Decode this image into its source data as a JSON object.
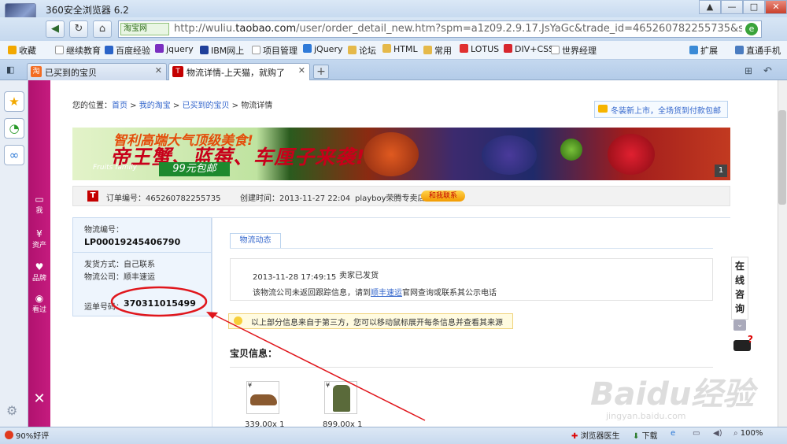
{
  "window": {
    "title": "360安全浏览器 6.2"
  },
  "nav": {
    "site_label": "淘宝网",
    "url_prefix": "http://wuliu.",
    "url_domain": "taobao.com",
    "url_suffix": "/user/order_detail_new.htm?spm=a1z09.2.9.17.JsYaGc&trade_id=465260782255735&seller_ic"
  },
  "bookmarks": {
    "favorites": "收藏",
    "items": [
      "继续教育",
      "百度经验",
      "jquery",
      "IBM网上",
      "项目管理",
      "jQuery",
      "论坛",
      "HTML",
      "常用",
      "LOTUS",
      "DIV+CSS",
      "世界经理"
    ],
    "extend": "扩展",
    "phone": "直通手机"
  },
  "tabs": [
    {
      "label": "已买到的宝贝"
    },
    {
      "label": "物流详情-上天猫，就购了"
    }
  ],
  "side_menu": [
    {
      "label": "我"
    },
    {
      "label": "资产"
    },
    {
      "label": "品牌"
    },
    {
      "label": "看过"
    }
  ],
  "breadcrumb": {
    "prefix": "您的位置：",
    "items": [
      "首页",
      "我的淘宝",
      "已买到的宝贝"
    ],
    "current": "物流详情",
    "sep": " > "
  },
  "promo": {
    "text": "冬装新上市，全场货到付款包邮"
  },
  "banner": {
    "line1": "智利高端大气顶级美食!",
    "line2": "帝王蟹、蓝莓、车厘子来袭!",
    "brand": "Fruits family",
    "price": "99元包邮",
    "page": "1"
  },
  "order": {
    "number_label": "订单编号：",
    "number": "465260782255735",
    "created_label": "创建时间：",
    "created": "2013-11-27 22:04",
    "shop": "playboy荣腾专卖店",
    "contact": "和我联系"
  },
  "logistics": {
    "no_label": "物流编号：",
    "no": "LP00019245406790",
    "method_label": "发货方式：",
    "method": "自己联系",
    "company_label": "物流公司：",
    "company": "顺丰速运",
    "waybill_label": "运单号码：",
    "waybill": "370311015499"
  },
  "tracking": {
    "tab": "物流动态",
    "time": "2013-11-28 17:49:15",
    "event": "卖家已发货",
    "note_pre": "该物流公司未返回跟踪信息，请到",
    "note_link": "顺丰速运",
    "note_post": "官网查询或联系其公示电话"
  },
  "tip": {
    "text": "以上部分信息来自于第三方，您可以移动鼠标展开每条信息并查看其来源"
  },
  "items_section": {
    "title": "宝贝信息：",
    "products": [
      {
        "price": "339.00x 1"
      },
      {
        "price": "899.00x 1"
      }
    ]
  },
  "chat": {
    "label": "在线咨询"
  },
  "status": {
    "rating": "90%好评",
    "doctor": "浏览器医生",
    "download": "下载",
    "zoom": "100%"
  },
  "watermark": {
    "main": "Baidu经验",
    "sub": "jingyan.baidu.com"
  },
  "colors": {
    "pink_bar": "#c51b7e",
    "link": "#3366cc",
    "annotation": "#e0161c"
  }
}
